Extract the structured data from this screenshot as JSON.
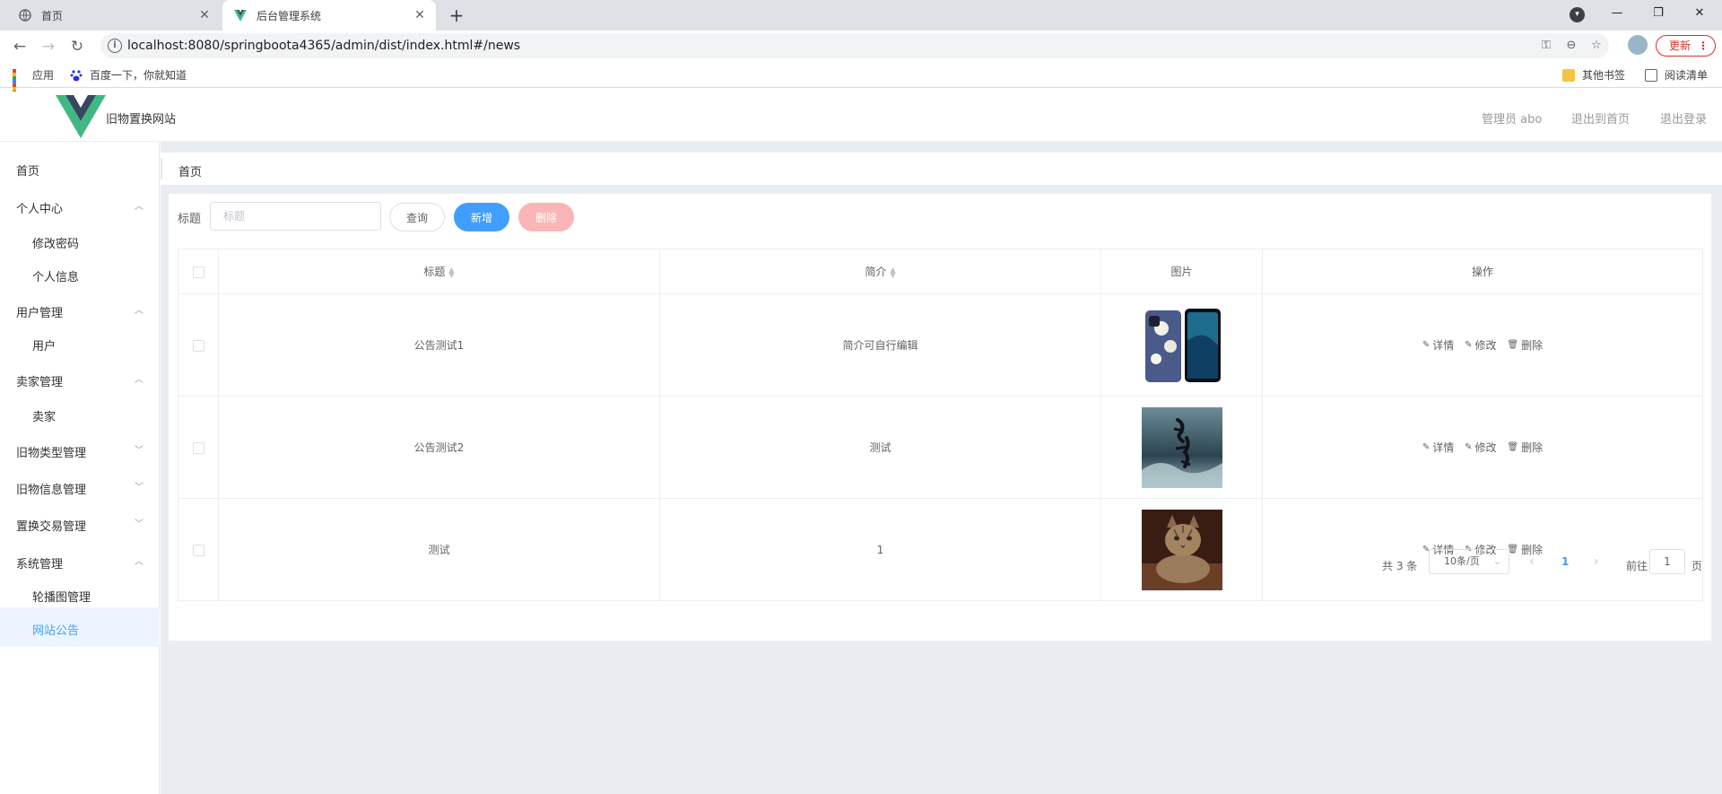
{
  "browser": {
    "tabs": [
      {
        "title": "首页"
      },
      {
        "title": "后台管理系统"
      }
    ],
    "url": "localhost:8080/springboota4365/admin/dist/index.html#/news",
    "update_label": "更新",
    "bookmarks": {
      "apps": "应用",
      "baidu": "百度一下，你就知道",
      "other": "其他书签",
      "reading_list": "阅读清单"
    }
  },
  "header": {
    "site_title": "旧物置换网站",
    "user": "管理员 abo",
    "back_home": "退出到首页",
    "logout": "退出登录"
  },
  "sidebar": {
    "items": [
      {
        "label": "首页",
        "level": "top"
      },
      {
        "label": "个人中心",
        "level": "top",
        "expanded": true
      },
      {
        "label": "修改密码",
        "level": "sub"
      },
      {
        "label": "个人信息",
        "level": "sub"
      },
      {
        "label": "用户管理",
        "level": "top",
        "expanded": true
      },
      {
        "label": "用户",
        "level": "sub"
      },
      {
        "label": "卖家管理",
        "level": "top",
        "expanded": true
      },
      {
        "label": "卖家",
        "level": "sub"
      },
      {
        "label": "旧物类型管理",
        "level": "top",
        "expanded": false
      },
      {
        "label": "旧物信息管理",
        "level": "top",
        "expanded": false
      },
      {
        "label": "置换交易管理",
        "level": "top",
        "expanded": false
      },
      {
        "label": "系统管理",
        "level": "top",
        "expanded": true
      },
      {
        "label": "轮播图管理",
        "level": "sub"
      },
      {
        "label": "网站公告",
        "level": "sub",
        "active": true
      }
    ]
  },
  "breadcrumb": "首页",
  "search": {
    "label": "标题",
    "placeholder": "标题",
    "query_label": "查询",
    "add_label": "新增",
    "delete_label": "删除"
  },
  "table": {
    "headers": {
      "title": "标题",
      "intro": "简介",
      "image": "图片",
      "actions": "操作"
    },
    "rows": [
      {
        "title": "公告测试1",
        "intro": "简介可自行编辑",
        "image": "phones"
      },
      {
        "title": "公告测试2",
        "intro": "测试",
        "image": "ink-landscape"
      },
      {
        "title": "测试",
        "intro": "1",
        "image": "cat"
      }
    ],
    "actions": {
      "detail": "详情",
      "edit": "修改",
      "delete": "删除"
    }
  },
  "pagination": {
    "total": "共 3 条",
    "page_size": "10条/页",
    "current_page": "1",
    "goto_label": "前往",
    "goto_value": "1",
    "unit": "页"
  },
  "colors": {
    "primary": "#409eff",
    "danger_light": "#fab6b6",
    "logo_green": "#41b883",
    "logo_dark": "#35495e"
  }
}
